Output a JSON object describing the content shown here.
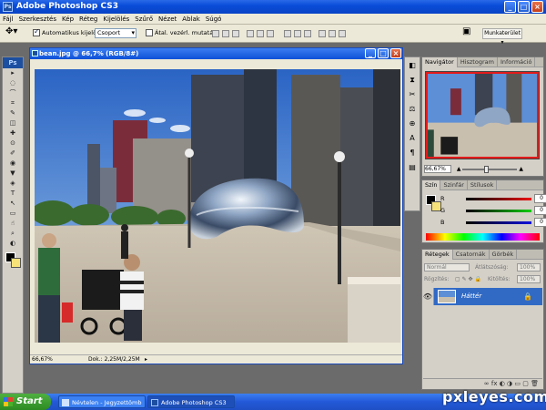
{
  "app": {
    "title": "Adobe Photoshop CS3",
    "ps_badge": "Ps"
  },
  "window_buttons": {
    "minimize": "_",
    "maximize": "□",
    "close": "×"
  },
  "menu": [
    "Fájl",
    "Szerkesztés",
    "Kép",
    "Réteg",
    "Kijelölés",
    "Szűrő",
    "Nézet",
    "Ablak",
    "Súgó"
  ],
  "options": {
    "auto_select_label": "Automatikus kijelölés:",
    "auto_select_checked": true,
    "auto_select_value": "Csoport",
    "transform_label": "Átal. vezérl. mutatása",
    "transform_checked": false,
    "workspace_label": "Munkaterület ▾"
  },
  "tools": [
    "▸",
    "◌",
    "⌒",
    "⌗",
    "✎",
    "◫",
    "✚",
    "⊙",
    "✐",
    "◉",
    "▼",
    "◈",
    "T",
    "↖",
    "▭",
    "☝",
    "⌕",
    "◐"
  ],
  "document": {
    "title": "bean.jpg @ 66,7% (RGB/8#)",
    "zoom": "66,67%",
    "doc_size": "Dok.: 2,25M/2,25M",
    "minimize": "_",
    "maximize": "□",
    "close": "×"
  },
  "side_icons": [
    "◧",
    "⧗",
    "✂",
    "⚖",
    "⊕",
    "A",
    "¶",
    "▤"
  ],
  "navigator": {
    "tabs": [
      "Navigátor",
      "Hisztogram",
      "Információ"
    ],
    "active_tab": 0,
    "zoom": "66,67%"
  },
  "color_panel": {
    "tabs": [
      "Szín",
      "Szinfár",
      "Stílusok"
    ],
    "active_tab": 0,
    "channels": [
      {
        "label": "R",
        "value": "0",
        "color": "#d22"
      },
      {
        "label": "G",
        "value": "0",
        "color": "#2a2"
      },
      {
        "label": "B",
        "value": "0",
        "color": "#22c"
      }
    ]
  },
  "layers": {
    "tabs": [
      "Rétegek",
      "Csatornák",
      "Görbék"
    ],
    "active_tab": 0,
    "blend_mode": "Normál",
    "opacity_label": "Átlátszóság:",
    "opacity": "100%",
    "lock_label": "Rögzítés:",
    "fill_label": "Kitöltés:",
    "fill": "100%",
    "layer_name": "Háttér",
    "footer_icons": [
      "∞",
      "fx",
      "◐",
      "◑",
      "▭",
      "▢",
      "🗑"
    ]
  },
  "taskbar": {
    "start": "Start",
    "tasks": [
      {
        "label": "Névtelen - Jegyzettömb"
      },
      {
        "label": "Adobe Photoshop CS3"
      }
    ]
  },
  "watermark": "pxleyes.com",
  "colors": {
    "xp_blue": "#0a4dd8",
    "selection": "#316ac5",
    "nav_frame": "#e31b1b"
  }
}
